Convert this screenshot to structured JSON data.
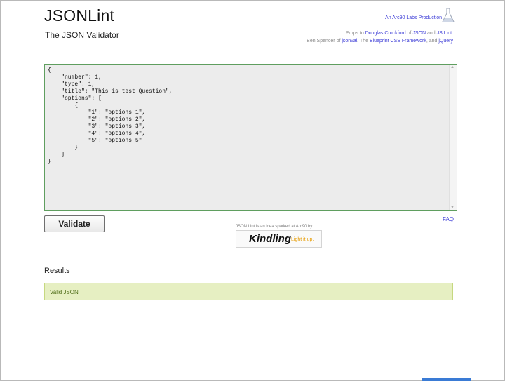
{
  "header": {
    "title": "JSONLint",
    "subtitle": "The JSON Validator",
    "production": "An Arc90 Labs Production",
    "props_line1": {
      "prefix": "Props to ",
      "link1": "Douglas Crockford",
      "mid1": " of ",
      "link2": "JSON",
      "mid2": " and ",
      "link3": "JS Lint",
      "suffix": "."
    },
    "props_line2": {
      "prefix": "Ben Spencer of ",
      "link1": "jsonval",
      "mid1": ". The ",
      "link2": "Blueprint CSS Framework",
      "mid2": ", and ",
      "link3": "jQuery"
    }
  },
  "editor": {
    "content": "{\n    \"number\": 1,\n    \"type\": 1,\n    \"title\": \"This is test Question\",\n    \"options\": [\n        {\n            \"1\": \"options 1\",\n            \"2\": \"options 2\",\n            \"3\": \"options 3\",\n            \"4\": \"options 4\",\n            \"5\": \"options 5\"\n        }\n    ]\n}"
  },
  "actions": {
    "validate_label": "Validate",
    "faq_label": "FAQ"
  },
  "promo": {
    "sparked_text": "JSON Lint is an idea sparked at Arc90 by",
    "kindling_label": "Kindling",
    "tagline": "Light it up."
  },
  "results": {
    "heading": "Results",
    "message": "Valid JSON"
  },
  "colors": {
    "link": "#3b3bd6",
    "success_bg": "#e6efc2",
    "success_border": "#c6d880",
    "editor_border": "#5f9e5f"
  }
}
